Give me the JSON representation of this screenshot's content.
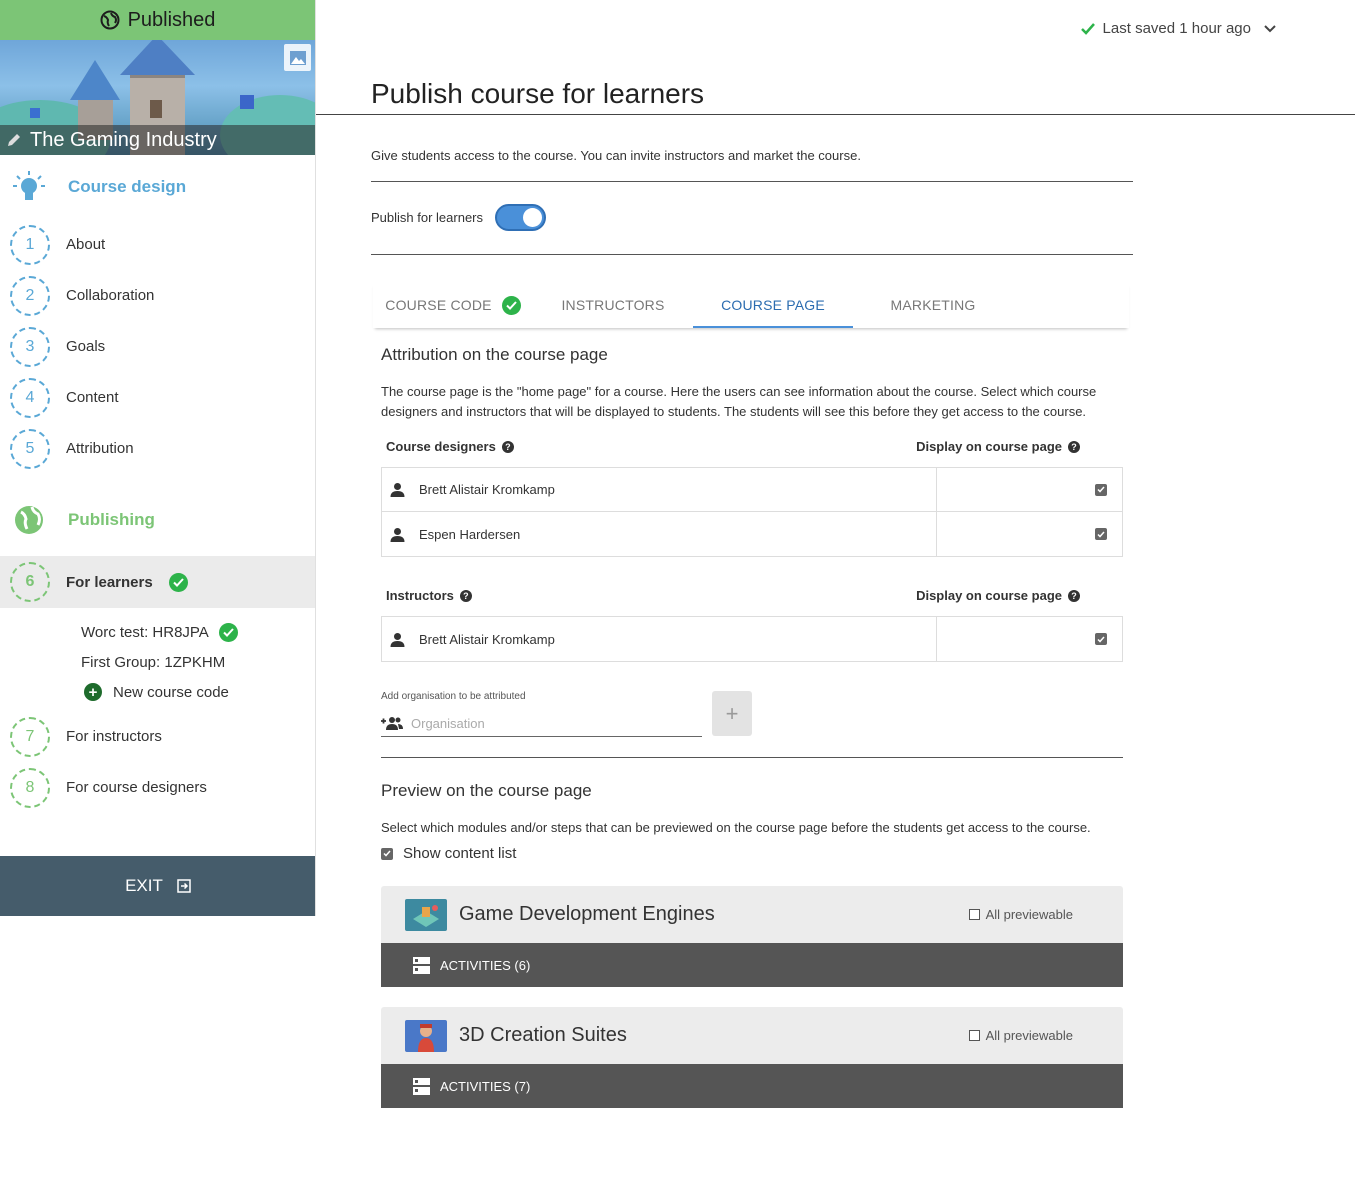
{
  "sidebar": {
    "status": "Published",
    "course_title": "The Gaming Industry",
    "design_header": "Course design",
    "design_items": [
      {
        "num": "1",
        "label": "About"
      },
      {
        "num": "2",
        "label": "Collaboration"
      },
      {
        "num": "3",
        "label": "Goals"
      },
      {
        "num": "4",
        "label": "Content"
      },
      {
        "num": "5",
        "label": "Attribution"
      }
    ],
    "publishing_header": "Publishing",
    "publishing_items": [
      {
        "num": "6",
        "label": "For learners"
      },
      {
        "num": "7",
        "label": "For instructors"
      },
      {
        "num": "8",
        "label": "For course designers"
      }
    ],
    "sub_items": [
      {
        "label": "Worc test: HR8JPA"
      },
      {
        "label": "First Group: 1ZPKHM"
      },
      {
        "label": "New course code"
      }
    ],
    "exit_label": "EXIT"
  },
  "header": {
    "saved_text": "Last saved 1 hour ago",
    "page_title": "Publish course for learners"
  },
  "main": {
    "intro": "Give students access to the course. You can invite instructors and market the course.",
    "toggle_label": "Publish for learners",
    "toggle_on": true,
    "tabs": [
      {
        "label": "COURSE CODE"
      },
      {
        "label": "INSTRUCTORS"
      },
      {
        "label": "COURSE PAGE"
      },
      {
        "label": "MARKETING"
      }
    ],
    "active_tab": "COURSE PAGE",
    "attribution_title": "Attribution on the course page",
    "attribution_text_1": "The course page is the \"home page\" for a course. Here the users can see information about the course. Select which course",
    "attribution_text_2": "designers and instructors that will be displayed to students. The students will see this before they get access to the course.",
    "designers_header": "Course designers",
    "display_header": "Display on course page",
    "designers": [
      {
        "name": "Brett Alistair Kromkamp",
        "displayed": true
      },
      {
        "name": "Espen Hardersen",
        "displayed": true
      }
    ],
    "instructors_header": "Instructors",
    "instructors": [
      {
        "name": "Brett Alistair Kromkamp",
        "displayed": true
      }
    ],
    "org_label": "Add organisation to be attributed",
    "org_placeholder": "Organisation",
    "preview_title": "Preview on the course page",
    "preview_text": "Select which modules and/or steps that can be previewed on the course page before the students get access to the course.",
    "show_content_list": "Show content list",
    "modules": [
      {
        "title": "Game Development Engines",
        "previewable": "All previewable",
        "activities": "ACTIVITIES (6)"
      },
      {
        "title": "3D Creation Suites",
        "previewable": "All previewable",
        "activities": "ACTIVITIES (7)"
      }
    ]
  },
  "colors": {
    "published_green": "#7cc576",
    "design_blue": "#5aa8d6",
    "check_green": "#2db34a",
    "exit_bg": "#455c6b",
    "tab_active": "#2b6cb0",
    "activities_bg": "#555555"
  }
}
